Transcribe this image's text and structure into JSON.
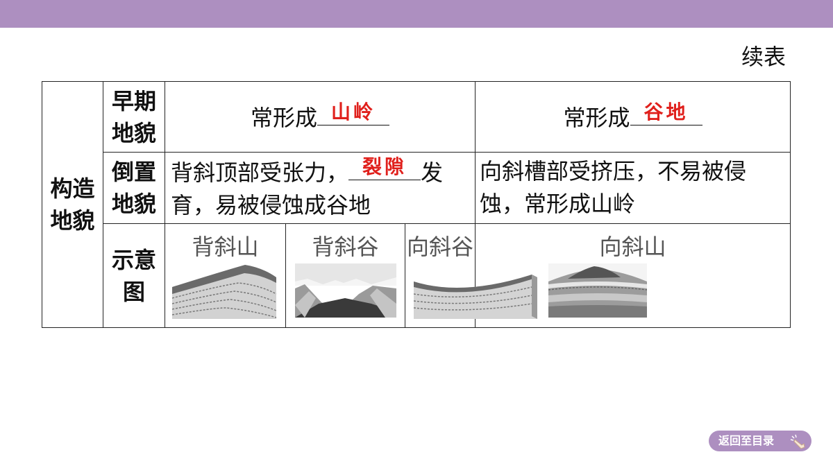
{
  "header": {
    "continued_label": "续表"
  },
  "table": {
    "group_label": "构造\n地貌",
    "rows": {
      "early": {
        "label": "早期\n地貌",
        "anticline": {
          "prefix": "常形成",
          "answer": "山岭"
        },
        "syncline": {
          "prefix": "常形成",
          "answer": "谷地"
        }
      },
      "inverted": {
        "label": "倒置\n地貌",
        "anticline": {
          "line1_prefix": "背斜顶部受张力，",
          "answer": "裂隙",
          "line1_suffix": "发",
          "line2": "育，易被侵蚀成谷地"
        },
        "syncline": {
          "line1": "向斜槽部受挤压，不易被侵",
          "line2": "蚀，常形成山岭"
        }
      },
      "diagram": {
        "label": "示意\n图",
        "panels": [
          {
            "title": "背斜山",
            "picture": "anticline-mountain"
          },
          {
            "title": "背斜谷",
            "picture": "anticline-valley"
          },
          {
            "title": "向斜谷",
            "picture": "syncline-valley"
          },
          {
            "title": "向斜山",
            "picture": "syncline-mountain"
          }
        ]
      }
    }
  },
  "nav": {
    "back_label": "返回至目录",
    "icon": "pointing-hand-icon"
  },
  "colors": {
    "accent": "#ad8fc0",
    "answer": "#e0201c"
  }
}
